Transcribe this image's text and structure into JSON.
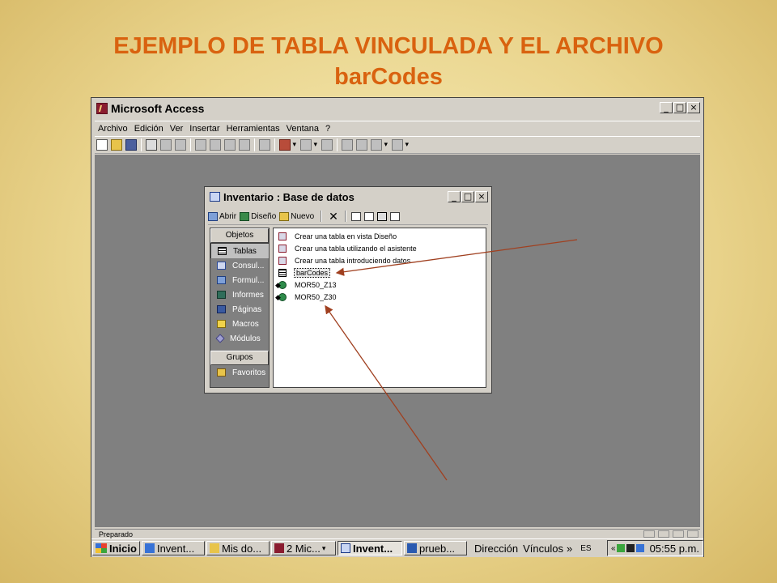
{
  "slide": {
    "title_line1": "EJEMPLO DE TABLA VINCULADA Y EL ARCHIVO",
    "title_line2": "barCodes"
  },
  "app": {
    "title": "Microsoft Access",
    "menu": [
      "Archivo",
      "Edición",
      "Ver",
      "Insertar",
      "Herramientas",
      "Ventana",
      "?"
    ],
    "status": "Preparado"
  },
  "db_window": {
    "title": "Inventario : Base de datos",
    "toolbar": {
      "open": "Abrir",
      "design": "Diseño",
      "new": "Nuevo"
    },
    "objects_header": "Objetos",
    "objects": [
      "Tablas",
      "Consul...",
      "Formul...",
      "Informes",
      "Páginas",
      "Macros",
      "Módulos"
    ],
    "groups_header": "Grupos",
    "groups": [
      "Favoritos"
    ],
    "list_items": [
      "Crear una tabla en vista Diseño",
      "Crear una tabla utilizando el asistente",
      "Crear una tabla introduciendo datos",
      "barCodes",
      "MOR50_Z13",
      "MOR50_Z30"
    ]
  },
  "taskbar": {
    "start": "Inicio",
    "buttons": [
      "Invent...",
      "Mis do...",
      "2 Mic...",
      "Invent...",
      "prueb..."
    ],
    "toolbar_label": "Dirección",
    "links": "Vínculos",
    "language": "ES",
    "clock": "05:55 p.m."
  },
  "colors": {
    "title": "#d9620f",
    "arrow": "#a04020",
    "workspace": "#808080"
  }
}
